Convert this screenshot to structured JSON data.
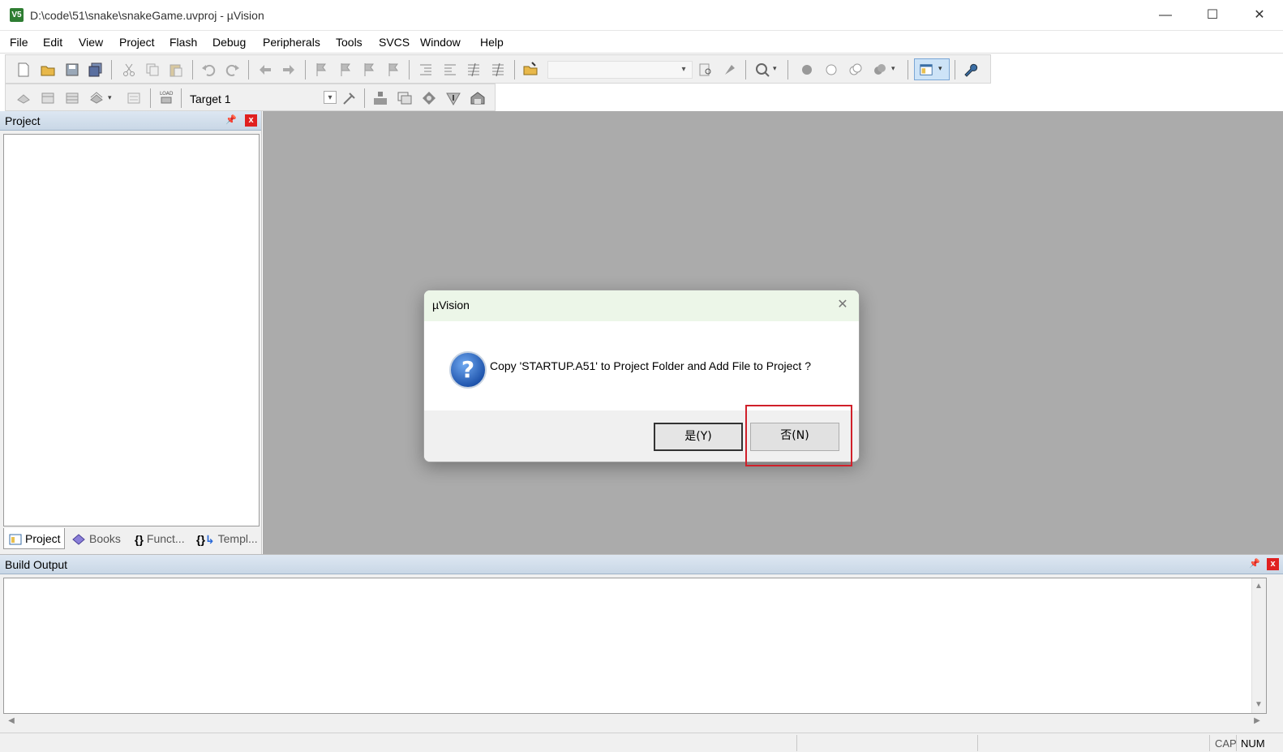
{
  "window": {
    "title": "D:\\code\\51\\snake\\snakeGame.uvproj - µVision",
    "app_icon_label": "V5",
    "minimize": "—",
    "maximize": "☐",
    "close": "✕"
  },
  "menu": [
    "File",
    "Edit",
    "View",
    "Project",
    "Flash",
    "Debug",
    "Peripherals",
    "Tools",
    "SVCS",
    "Window",
    "Help"
  ],
  "build_toolbar": {
    "target_select_value": "Target 1"
  },
  "project_panel": {
    "title": "Project",
    "pin": "ᵖ",
    "close": "x",
    "tabs": [
      {
        "label": "Project",
        "icon": "project-tab-icon"
      },
      {
        "label": "Books",
        "icon": "books-tab-icon"
      },
      {
        "label": "Funct...",
        "icon": "functions-tab-icon"
      },
      {
        "label": "Templ...",
        "icon": "templates-tab-icon"
      }
    ]
  },
  "build_output": {
    "title": "Build Output",
    "pin": "ᵖ",
    "close": "x"
  },
  "statusbar": {
    "cap": "CAP",
    "num": "NUM"
  },
  "dialog": {
    "title": "µVision",
    "close": "✕",
    "message": "Copy 'STARTUP.A51' to Project Folder and Add File to Project ?",
    "yes_label": "是(Y)",
    "no_label": "否(N)"
  },
  "colors": {
    "editor_background": "#ababab",
    "dialog_titlebar": "#ecf6e8",
    "highlight_box": "#d0202a",
    "panel_close": "#e02020"
  }
}
